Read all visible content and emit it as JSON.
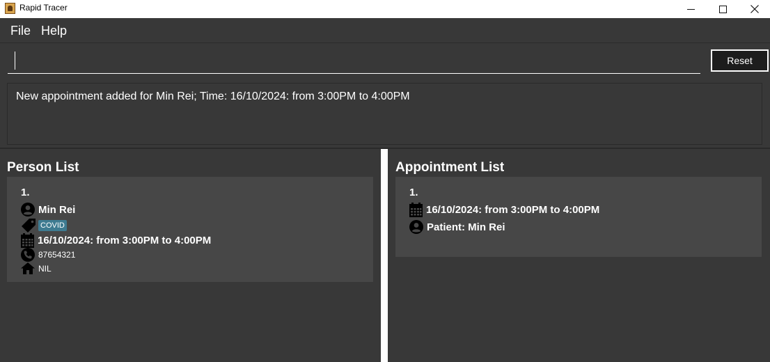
{
  "window": {
    "title": "Rapid Tracer"
  },
  "menu": {
    "file": "File",
    "help": "Help"
  },
  "command": {
    "value": "",
    "reset_label": "Reset"
  },
  "result": {
    "text": "New appointment added for Min Rei; Time: 16/10/2024: from 3:00PM to 4:00PM"
  },
  "person_list": {
    "title": "Person List",
    "persons": [
      {
        "index": "1.",
        "name": "Min Rei",
        "tag": "COVID",
        "appointment": "16/10/2024: from 3:00PM to 4:00PM",
        "phone": "87654321",
        "address": "NIL"
      }
    ]
  },
  "appointment_list": {
    "title": "Appointment List",
    "appointments": [
      {
        "index": "1.",
        "time": "16/10/2024: from 3:00PM to 4:00PM",
        "patient": "Patient: Min Rei"
      }
    ]
  },
  "icons": {
    "person": "person-icon",
    "tag": "tag-icon",
    "calendar": "calendar-icon",
    "phone": "phone-icon",
    "home": "home-icon"
  },
  "colors": {
    "tag_bg": "#3e7b91",
    "background": "#383838",
    "card": "#474747"
  }
}
